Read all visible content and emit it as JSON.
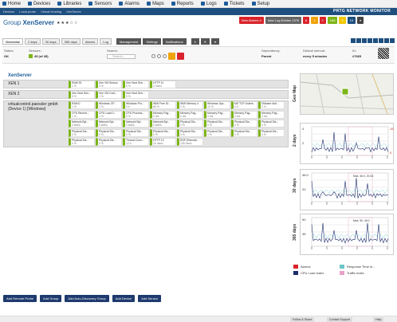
{
  "nav": [
    "Home",
    "Devices",
    "Libraries",
    "Sensors",
    "Alarms",
    "Maps",
    "Reports",
    "Logs",
    "Tickets",
    "Setup"
  ],
  "breadcrumbs": [
    "Devices",
    "Local probe",
    "Virtual Hosting",
    "XenServer"
  ],
  "brand": "PRTG NETWORK MONITOR",
  "page": {
    "prefix": "Group",
    "name": "XenServer",
    "stars": "★★★☆☆"
  },
  "alerts": [
    {
      "label": "New Alarms 4",
      "color": "#d9242b"
    },
    {
      "label": "New Log Entries 1376",
      "color": "#666666"
    },
    {
      "label": "6",
      "color": "#d9242b"
    },
    {
      "label": "1",
      "color": "#f0a30a"
    },
    {
      "label": "2",
      "color": "#d9242b"
    },
    {
      "label": "166",
      "color": "#7cb518"
    },
    {
      "label": "3",
      "color": "#f0c800"
    },
    {
      "label": "10",
      "color": "#1e4f7f"
    },
    {
      "label": "▾",
      "color": "#444444"
    }
  ],
  "tabs": [
    "Overview",
    "2 days",
    "30 days",
    "365 days",
    "Alarms",
    "Log"
  ],
  "tabs2": [
    "Management",
    "Settings",
    "Notifications"
  ],
  "info": {
    "status_label": "Status:",
    "status": "OK",
    "sensors_label": "Sensors:",
    "sensors": "45 (of 45)",
    "search_label": "Search:",
    "search_placeholder": "Search...",
    "dependency_label": "Dependency:",
    "dependency": "Parent",
    "interval_label": "Default Interval:",
    "interval": "every 5 minutes",
    "id_label": "ID:",
    "id": "#7665"
  },
  "tree_title": "XenServer",
  "devices": [
    {
      "name": "XEN 1",
      "sensors": [
        [
          "RAM 33",
          "1 %"
        ],
        [
          "Xen VM Sensor",
          "3 %"
        ],
        [
          "Xen Host Sen...",
          "5 %"
        ],
        [
          "HTTP 11",
          "4 msec"
        ]
      ]
    },
    {
      "name": "XEN 2",
      "sensors": [
        [
          "Xen Host Sen...",
          "5 %"
        ],
        [
          "Xen VM Cont...",
          "1 %"
        ],
        [
          "Xen Host Sen...",
          "3 %"
        ]
      ]
    },
    {
      "name": "virtualcontrol.paessler gmbh (Device 1) [Windows]",
      "sensors": [
        [
          "RAM 0",
          "1 %"
        ],
        [
          "Windows CP...",
          "1 %"
        ],
        [
          "Windows Pro...",
          "0 #"
        ],
        [
          "WMI Free Di...",
          "66 %"
        ],
        [
          "WMI Memory 4",
          "1 %"
        ],
        [
          "Windows Sys...",
          "12 %"
        ],
        [
          "MS TCP Listeni...",
          "0 #"
        ],
        [
          "VMware Acti...",
          "0 %"
        ],
        [
          "CPU Recent...",
          "1 %"
        ],
        [
          "CPU Load 0...",
          "1 %"
        ],
        [
          "CPU Process...",
          "0 %"
        ],
        [
          "Memory Pag...",
          "0 #/s"
        ],
        [
          "Memory Pag...",
          "0 #/s"
        ],
        [
          "Memory Pag...",
          "0 #/s"
        ],
        [
          "Memory Pag...",
          "0 #/s"
        ],
        [
          "Memory Pag...",
          "0 #/s"
        ],
        [
          "Network Byt...",
          "0 kbit/s"
        ],
        [
          "Network Byt...",
          "0 kbit/s"
        ],
        [
          "Network Byt...",
          "0 kbit/s"
        ],
        [
          "Network Byt...",
          "0 kbit/s"
        ],
        [
          "Physical Dis...",
          "0 %"
        ],
        [
          "Physical Dis...",
          "0 %"
        ],
        [
          "Physical Dis...",
          "0 %"
        ],
        [
          "Physical Dis...",
          "0 %"
        ],
        [
          "Physical Dis...",
          "0 %"
        ],
        [
          "Physical Dis...",
          "0 %"
        ],
        [
          "Physical Dis...",
          "0 %"
        ],
        [
          "Physical Dis...",
          "0 %"
        ],
        [
          "Physical Dis...",
          "0 %"
        ],
        [
          "Physical Dis...",
          "0 %"
        ],
        [
          "Physical Dis...",
          "0 %"
        ],
        [
          "Physical Dis...",
          "0 %"
        ],
        [
          "Physical Dis...",
          "0 %"
        ],
        [
          "Physical Dis...",
          "0 %"
        ],
        [
          "Thread Coun...",
          "12 #"
        ],
        [
          "HTTP 13",
          "20 msec"
        ],
        [
          "RDP (Remote...",
          "135 msec"
        ]
      ]
    }
  ],
  "right_labels": [
    "Geo Map",
    "2 days",
    "30 days",
    "365 days"
  ],
  "chart_data": [
    {
      "type": "line",
      "title": "2 days",
      "ylabel": "",
      "values_label_left": [
        "4",
        "2"
      ],
      "values_label_right": [
        "15",
        "0"
      ]
    },
    {
      "type": "line",
      "title": "30 days",
      "values_label_left": [
        "46.0",
        "20"
      ],
      "annotation": "Max. 46.0, 20.04"
    },
    {
      "type": "line",
      "title": "365 days",
      "values_label_left": [
        "90",
        "45"
      ],
      "annotation": "Max. 90, 45.0"
    }
  ],
  "legend": [
    {
      "label": "Alarms",
      "color": "#d9242b"
    },
    {
      "label": "Response Time In...",
      "color": "#6fc6c6"
    },
    {
      "label": "CPU Load Index",
      "color": "#1e2d6e"
    },
    {
      "label": "Traffic Index",
      "color": "#e8a0c8"
    }
  ],
  "add_buttons": [
    "Add Remote Probe",
    "Add Group",
    "Add Auto-Discovery Group",
    "Add Device",
    "Add Sensor"
  ],
  "footer": [
    "Follow & Share",
    "Contact Support",
    "Help"
  ]
}
